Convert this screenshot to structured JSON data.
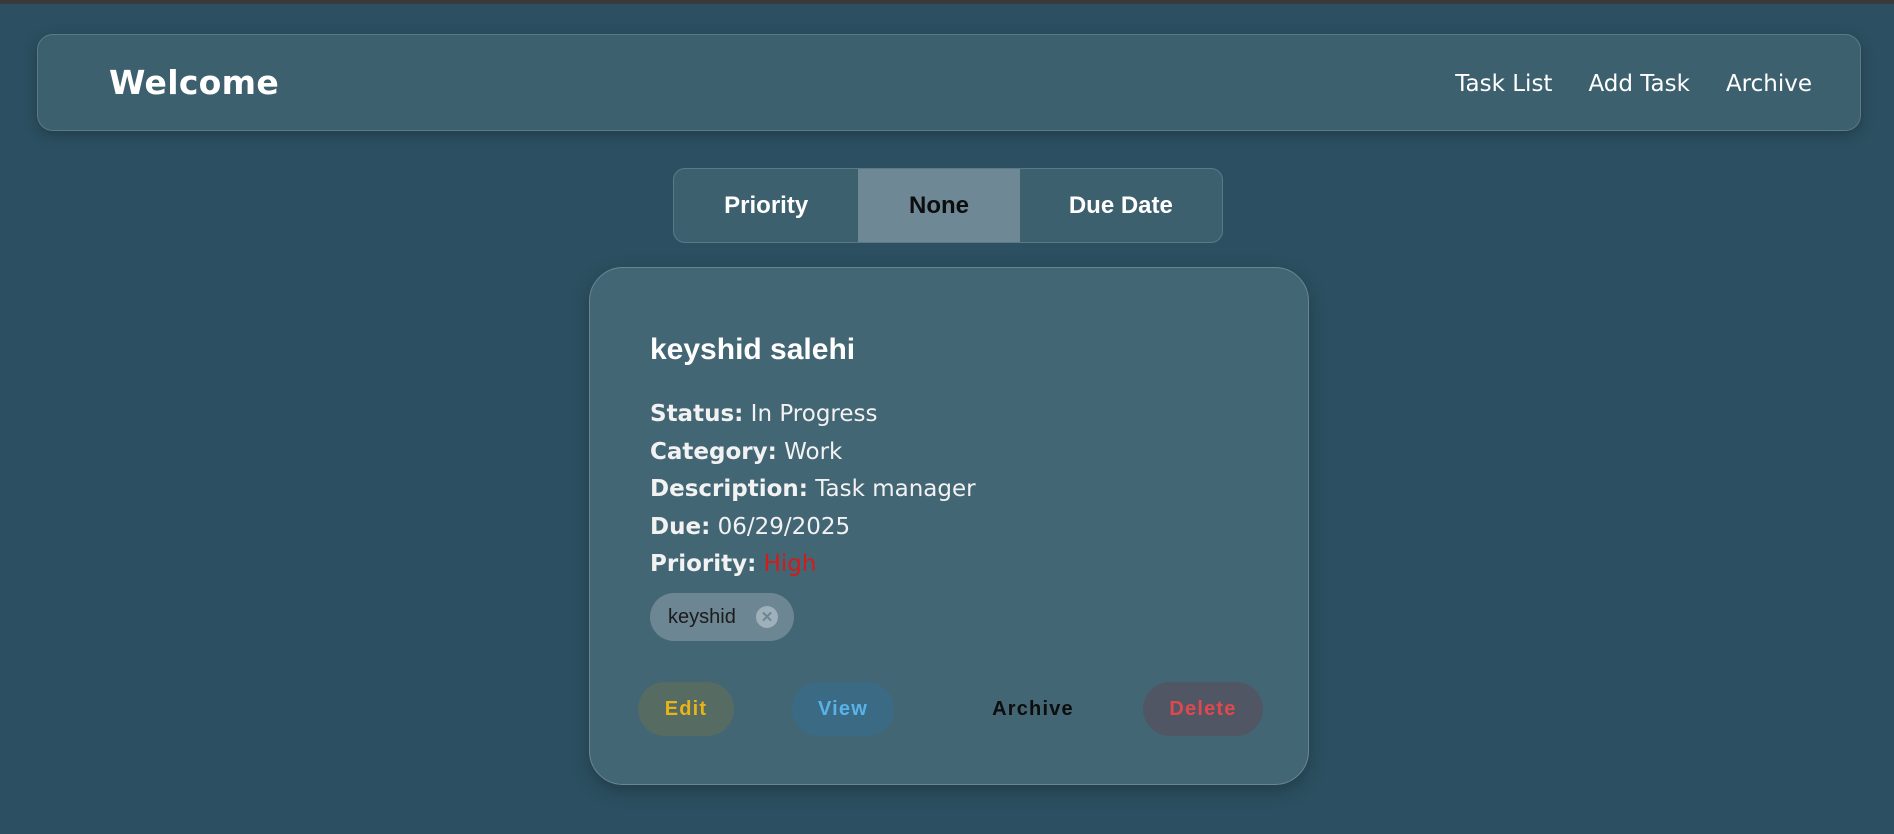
{
  "header": {
    "title": "Welcome",
    "nav": [
      "Task List",
      "Add Task",
      "Archive"
    ]
  },
  "sort_toggle": {
    "options": [
      "Priority",
      "None",
      "Due Date"
    ],
    "selected": "None"
  },
  "task": {
    "title": "keyshid salehi",
    "status_label": "Status:",
    "status": "In Progress",
    "category_label": "Category:",
    "category": "Work",
    "description_label": "Description:",
    "description": "Task manager",
    "due_label": "Due:",
    "due": "06/29/2025",
    "priority_label": "Priority:",
    "priority": "High",
    "tags": [
      "keyshid"
    ],
    "tag_remove_glyph": "✕"
  },
  "actions": {
    "edit": "Edit",
    "view": "View",
    "archive": "Archive",
    "delete": "Delete"
  },
  "colors": {
    "background": "#2c5061",
    "priority_high": "#d01c1c",
    "edit": "#e8b418",
    "view": "#59b3e8",
    "delete": "#e0484d"
  }
}
